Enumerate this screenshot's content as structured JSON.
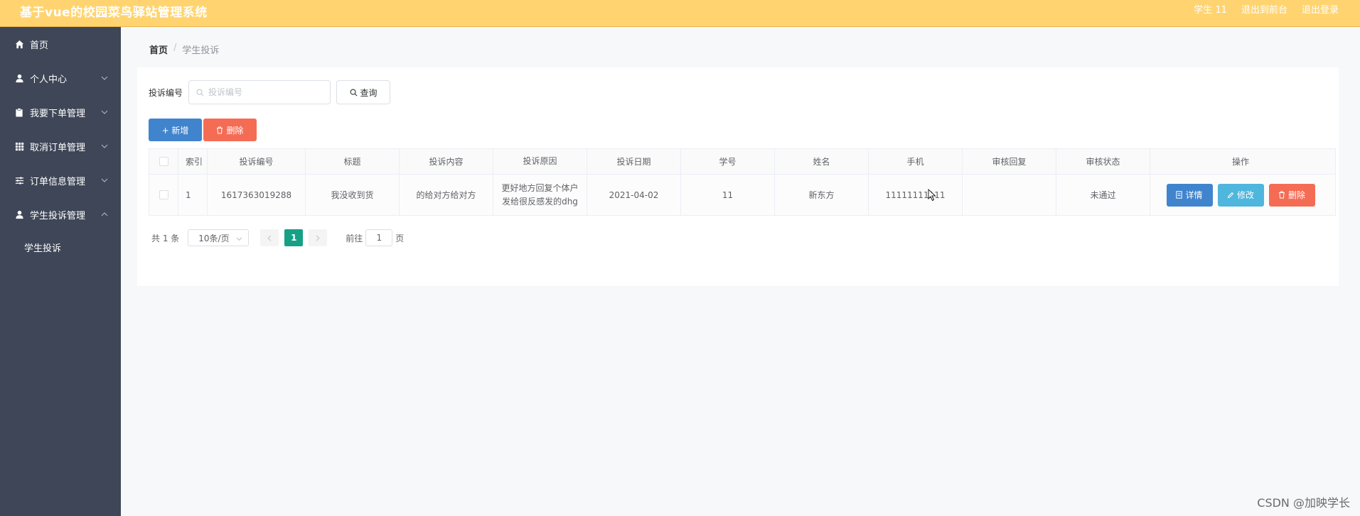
{
  "header": {
    "title": "基于vue的校园菜鸟驿站管理系统",
    "user": "学生 11",
    "back_frontend": "退出到前台",
    "logout": "退出登录"
  },
  "sidebar": {
    "items": [
      {
        "label": "首页",
        "icon": "home-icon"
      },
      {
        "label": "个人中心",
        "icon": "user-icon"
      },
      {
        "label": "我要下单管理",
        "icon": "clipboard-icon"
      },
      {
        "label": "取消订单管理",
        "icon": "grid-icon"
      },
      {
        "label": "订单信息管理",
        "icon": "sliders-icon"
      },
      {
        "label": "学生投诉管理",
        "icon": "user-icon"
      }
    ],
    "sub_item": "学生投诉"
  },
  "breadcrumb": {
    "home": "首页",
    "separator": "/",
    "current": "学生投诉"
  },
  "search": {
    "label": "投诉编号",
    "placeholder": "投诉编号",
    "query_label": "查询"
  },
  "actions": {
    "add_label": "+ 新增",
    "delete_label": "删除"
  },
  "table": {
    "headers": {
      "index": "索引",
      "complaint_no": "投诉编号",
      "title": "标题",
      "content": "投诉内容",
      "reason": "投诉原因",
      "date": "投诉日期",
      "student_id": "学号",
      "name": "姓名",
      "phone": "手机",
      "reply": "审核回复",
      "status": "审核状态",
      "operations": "操作"
    },
    "rows": [
      {
        "index": "1",
        "complaint_no": "1617363019288",
        "title": "我没收到货",
        "content": "的给对方给对方",
        "reason": "更好地方回复个体户发给很反感发的dhg",
        "date": "2021-04-02",
        "student_id": "11",
        "name": "新东方",
        "phone": "11111111111",
        "reply": "",
        "status": "未通过",
        "detail_label": "详情",
        "edit_label": "修改",
        "delete_label": "删除"
      }
    ]
  },
  "pagination": {
    "total": "共 1 条",
    "page_size": "10条/页",
    "current_page": "1",
    "goto_prefix": "前往",
    "goto_value": "1",
    "goto_suffix": "页"
  },
  "watermark": "CSDN @加映学长",
  "colors": {
    "header_bg": "#ffd470",
    "sidebar_bg": "#3e4657",
    "primary": "#4084ce",
    "info": "#4fb6dd",
    "danger": "#f56c55",
    "page_active": "#16a085"
  }
}
